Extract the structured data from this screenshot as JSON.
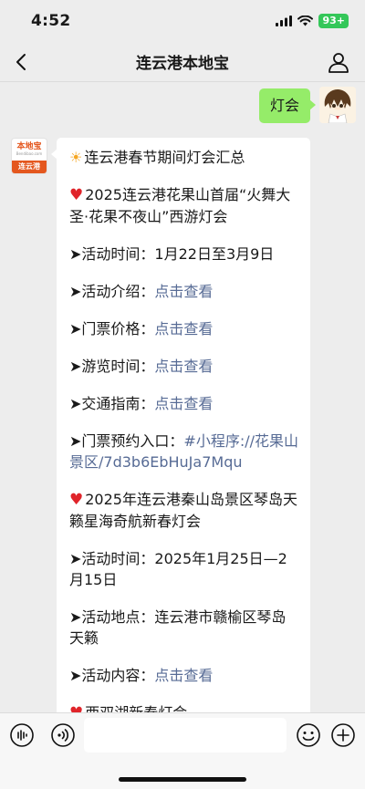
{
  "status_bar": {
    "time": "4:52",
    "battery": "93+"
  },
  "header": {
    "title": "连云港本地宝"
  },
  "outgoing": {
    "text": "灯会"
  },
  "bot_avatar": {
    "logo_text": "本地宝",
    "logo_domain": "Bendibao.com",
    "logo_city": "连云港"
  },
  "message": {
    "lines": [
      {
        "type": "sun",
        "text": "连云港春节期间灯会汇总"
      },
      {
        "type": "gap"
      },
      {
        "type": "heart",
        "text": "2025连云港花果山首届“火舞大圣·花果不夜山”西游灯会"
      },
      {
        "type": "gap"
      },
      {
        "type": "text",
        "text": "➤活动时间：1月22日至3月9日"
      },
      {
        "type": "gap"
      },
      {
        "type": "link",
        "prefix": "➤活动介绍：",
        "link": "点击查看"
      },
      {
        "type": "gap"
      },
      {
        "type": "link",
        "prefix": "➤门票价格：",
        "link": "点击查看"
      },
      {
        "type": "gap"
      },
      {
        "type": "link",
        "prefix": "➤游览时间：",
        "link": "点击查看"
      },
      {
        "type": "gap"
      },
      {
        "type": "link",
        "prefix": "➤交通指南：",
        "link": "点击查看"
      },
      {
        "type": "gap"
      },
      {
        "type": "link",
        "prefix": "➤门票预约入口：",
        "link": "#小程序://花果山景区/7d3b6EbHuJa7Mqu"
      },
      {
        "type": "gap"
      },
      {
        "type": "heart",
        "text": "2025年连云港秦山岛景区琴岛天籁星海奇航新春灯会"
      },
      {
        "type": "gap"
      },
      {
        "type": "text",
        "text": "➤活动时间：2025年1月25日—2月15日"
      },
      {
        "type": "gap"
      },
      {
        "type": "text",
        "text": "➤活动地点：连云港市赣榆区琴岛天籁"
      },
      {
        "type": "gap"
      },
      {
        "type": "link",
        "prefix": "➤活动内容：",
        "link": "点击查看"
      },
      {
        "type": "gap"
      },
      {
        "type": "heart",
        "text": "西双湖新春灯会"
      }
    ]
  },
  "input": {
    "placeholder": ""
  },
  "colors": {
    "bubble_out": "#95ec69",
    "link": "#576b95",
    "background": "#ededed",
    "brand": "#e4571e",
    "battery": "#34c759"
  },
  "icons": [
    "back-icon",
    "profile-icon",
    "voice-icon",
    "emoji-icon",
    "add-icon",
    "sun-icon",
    "heart-icon",
    "signal-icon",
    "wifi-icon"
  ]
}
